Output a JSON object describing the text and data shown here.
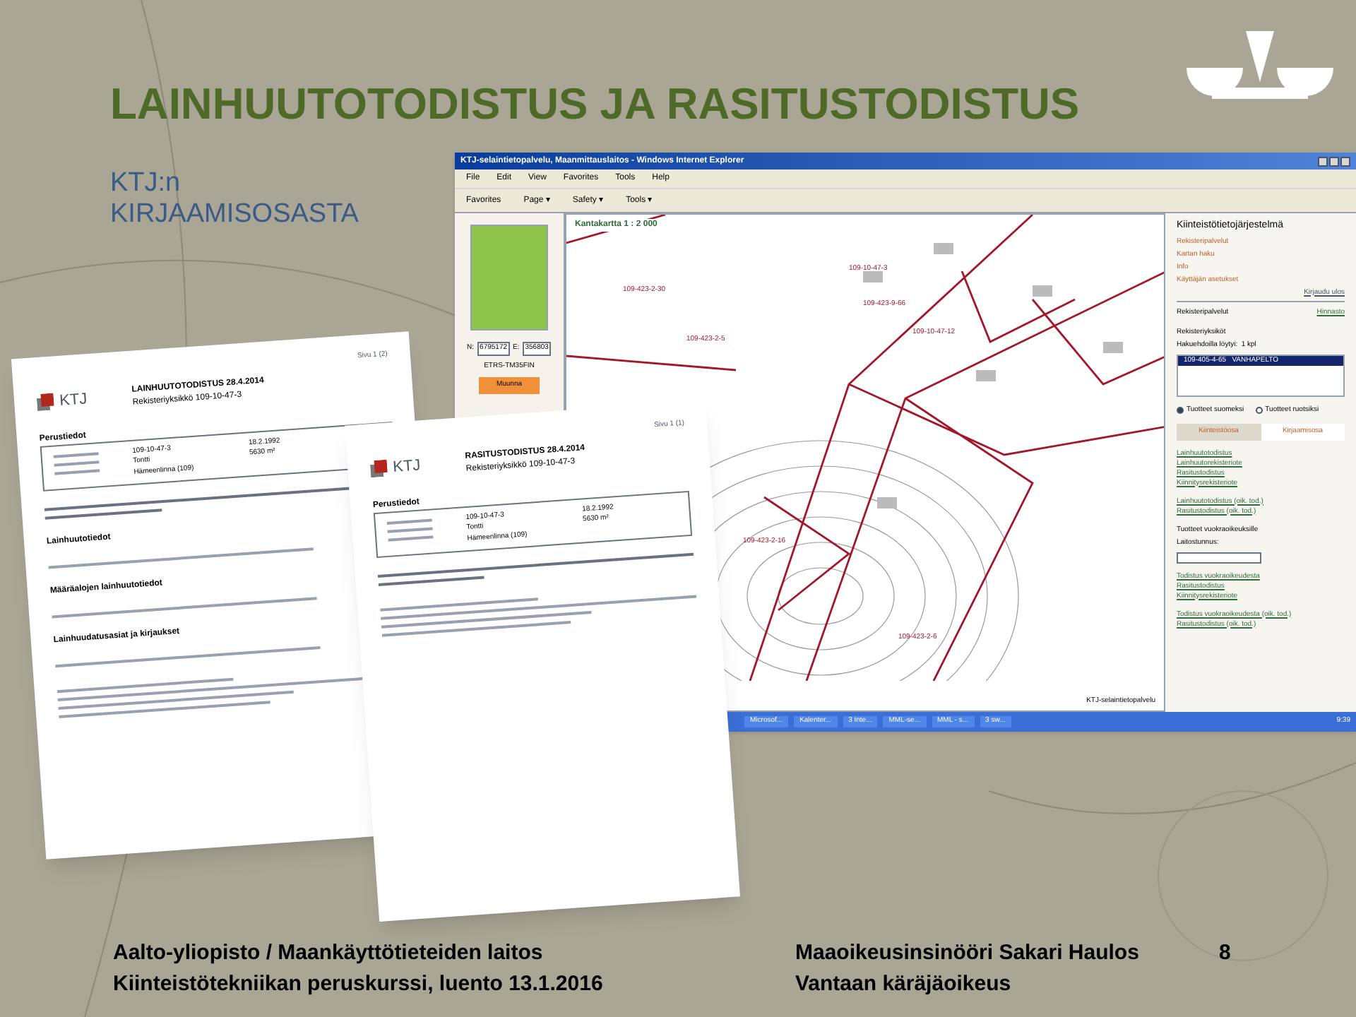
{
  "title": "LAINHUUTOTODISTUS JA RASITUSTODISTUS",
  "subtitle": [
    "KTJ:n",
    "KIRJAAMISOSASTA"
  ],
  "browser": {
    "title": "KTJ-selaintietopalvelu, Maanmittauslaitos - Windows Internet Explorer",
    "menu": [
      "File",
      "Edit",
      "View",
      "Favorites",
      "Tools",
      "Help"
    ],
    "toolbar": [
      "Favorites",
      "Page ▾",
      "Safety ▾",
      "Tools ▾"
    ],
    "coords": {
      "n_label": "N:",
      "n_value": "6795172",
      "e_label": "E:",
      "e_value": "356803",
      "system": "ETRS-TM35FIN",
      "button": "Muunna"
    },
    "map": {
      "scale": "Kantakartta 1 : 2 000",
      "parcels": [
        "109-423-2-30",
        "109-10-47-3",
        "109-423-9-66",
        "109-423-2-5",
        "109-10-47-12",
        "109-423-2-16",
        "109-423-2-6"
      ],
      "footer_label": "KTJ-selaintietopalvelu"
    },
    "panel": {
      "heading": "Kiinteistötietojärjestelmä",
      "nav_links": [
        "Rekisteripalvelut",
        "Kartan haku",
        "Info",
        "Käyttäjän asetukset"
      ],
      "logout": "Kirjaudu ulos",
      "section": "Rekisteripalvelut",
      "price_link": "Hinnasto",
      "results_heading": "Rekisteriyksiköt",
      "results_count": "Hakuehdoilla löytyi:  1 kpl",
      "results": [
        {
          "text": "109-405-4-65   VANHAPELTO",
          "selected": true
        }
      ],
      "radios": [
        {
          "label": "Tuotteet suomeksi",
          "selected": true
        },
        {
          "label": "Tuotteet ruotsiksi",
          "selected": false
        }
      ],
      "tabs": [
        {
          "label": "Kiinteistöosa",
          "selected": false
        },
        {
          "label": "Kirjaamisosa",
          "selected": true
        }
      ],
      "link_groups": [
        [
          "Lainhuutotodistus",
          "Lainhuutorekisteriote",
          "Rasitustodistus",
          "Kiinnitysrekisteriote"
        ],
        [
          "Lainhuutotodistus (oik. tod.)",
          "Rasitustodistus (oik. tod.)"
        ]
      ],
      "lease_heading": "Tuotteet vuokraoikeuksille",
      "field_label": "Laitostunnus:",
      "lease_groups": [
        [
          "Todistus vuokraoikeudesta",
          "Rasitustodistus",
          "Kiinnitysrekisteriote"
        ],
        [
          "Todistus vuokraoikeudesta (oik. tod.)",
          "Rasitustodistus (oik. tod.)"
        ]
      ]
    },
    "taskbar": {
      "items": [
        "Microsof...",
        "Kalenter...",
        "3 Inte...",
        "MML-se...",
        "MML - s...",
        "3 sw..."
      ],
      "clock": "9:39"
    }
  },
  "documents": [
    {
      "page": "Sivu 1 (2)",
      "logo": "KTJ",
      "title": "LAINHUUTOTODISTUS 28.4.2014",
      "subtitle": "Rekisteriyksikkö 109-10-47-3",
      "section": "Perustiedot",
      "values": [
        "109-10-47-3",
        "Tontti",
        "Hämeenlinna (109)"
      ],
      "right_values": [
        "18.2.1992",
        "5630 m²"
      ],
      "sections": [
        "Lainhuutotiedot",
        "Määräalojen lainhuutotiedot",
        "Lainhuudatusasiat ja kirjaukset"
      ]
    },
    {
      "page": "Sivu 1 (1)",
      "logo": "KTJ",
      "title": "RASITUSTODISTUS 28.4.2014",
      "subtitle": "Rekisteriyksikkö 109-10-47-3",
      "section": "Perustiedot",
      "values": [
        "109-10-47-3",
        "Tontti",
        "Hämeenlinna (109)"
      ],
      "right_values": [
        "18.2.1992",
        "5630 m²"
      ]
    }
  ],
  "footer": {
    "left": [
      "Aalto-yliopisto / Maankäyttötieteiden laitos",
      "Kiinteistötekniikan peruskurssi, luento 13.1.2016"
    ],
    "right": [
      "Maaoikeusinsinööri Sakari Haulos",
      "Vantaan käräjäoikeus"
    ],
    "page": "8"
  }
}
